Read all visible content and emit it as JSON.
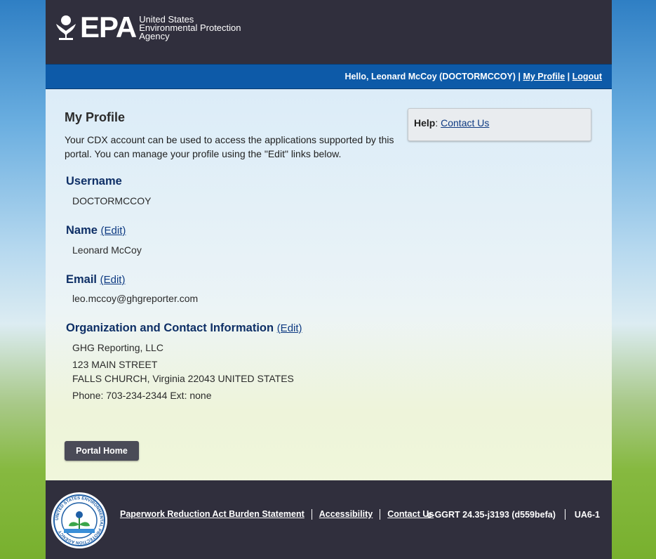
{
  "header": {
    "logo_text": "EPA",
    "agency_line1": "United States",
    "agency_line2": "Environmental Protection",
    "agency_line3": "Agency"
  },
  "userbar": {
    "greeting": "Hello, Leonard McCoy (DOCTORMCCOY)",
    "separator": "|",
    "my_profile": "My Profile",
    "logout": "Logout"
  },
  "profile": {
    "title": "My Profile",
    "intro": "Your CDX account can be used to access the applications supported by this portal. You can manage your profile using the \"Edit\" links below.",
    "username_label": "Username",
    "username_value": "DOCTORMCCOY",
    "name_label": "Name",
    "name_value": "Leonard McCoy",
    "email_label": "Email",
    "email_value": "leo.mccoy@ghgreporter.com",
    "org_label": "Organization and Contact Information",
    "org_name": "GHG Reporting, LLC",
    "address_line1": "123 MAIN STREET",
    "address_line2": "FALLS CHURCH, Virginia 22043 UNITED STATES",
    "phone": "Phone: 703-234-2344 Ext: none",
    "edit_link": "(Edit)"
  },
  "help": {
    "label": "Help",
    "colon": ":",
    "link": "Contact Us"
  },
  "portal_home_button": "Portal Home",
  "footer": {
    "seal_text": "UNITED STATES ENVIRONMENTAL PROTECTION AGENCY",
    "links": [
      "Paperwork Reduction Act Burden Statement",
      "Accessibility",
      "Contact Us"
    ],
    "version": "e-GGRT 24.35-j3193 (d559befa)",
    "code": "UA6-1"
  },
  "colors": {
    "header_bg": "#302f3d",
    "userbar_bg": "#0d5aa8",
    "heading_blue": "#0e2f66",
    "button_bg": "#4a4b57"
  }
}
